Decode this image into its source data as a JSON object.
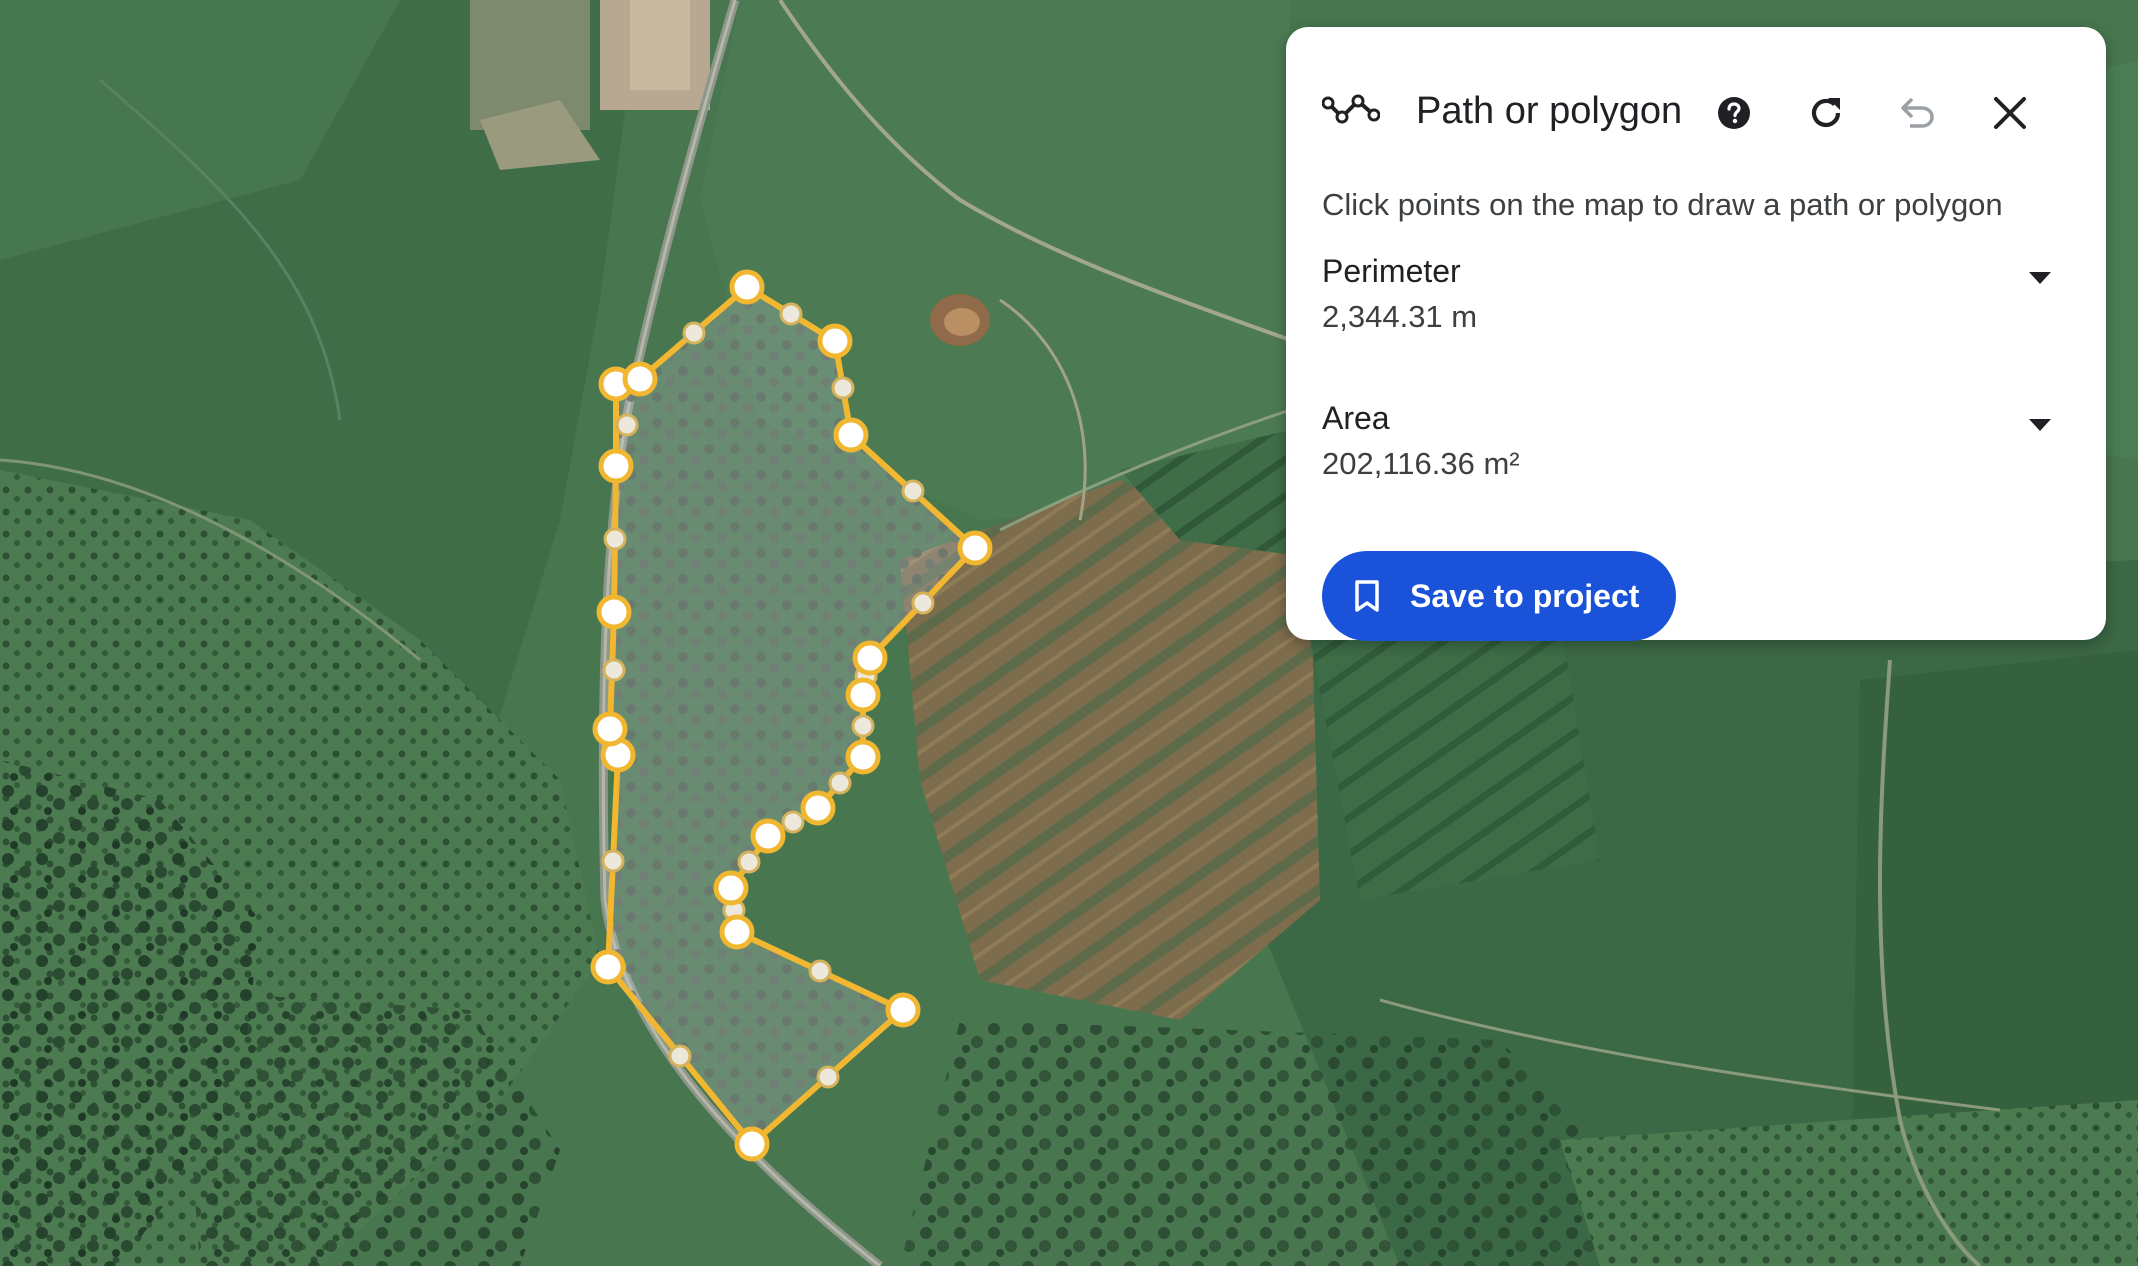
{
  "map": {
    "view": "satellite",
    "polygon_color": "#f1b731",
    "vertex_color": "#ffffff"
  },
  "panel": {
    "tool_icon": "path-polygon-icon",
    "title": "Path or polygon",
    "actions": [
      {
        "icon": "help-icon"
      },
      {
        "icon": "reset-icon"
      },
      {
        "icon": "undo-icon",
        "enabled": false
      },
      {
        "icon": "close-icon"
      }
    ],
    "instructions": "Click points on the map to draw a path or polygon",
    "perimeter": {
      "label": "Perimeter",
      "value": "2,344.31 m",
      "caret_icon": "caret-down-icon"
    },
    "area": {
      "label": "Area",
      "value": "202,116.36 m²",
      "caret_icon": "caret-down-icon"
    },
    "save_button": {
      "icon": "bookmark-icon",
      "label": "Save to project",
      "color": "#1a53d9"
    }
  }
}
